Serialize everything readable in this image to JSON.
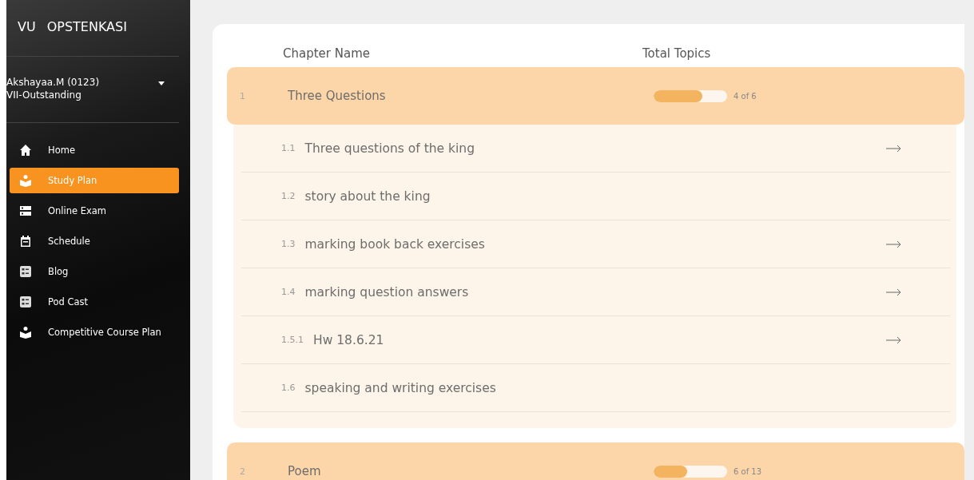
{
  "brand": {
    "short": "VU",
    "name": "OPSTENKASI"
  },
  "user": {
    "name": "Akshayaa.M (0123)",
    "class": "VII-Outstanding"
  },
  "sidebar": {
    "items": [
      {
        "label": "Home",
        "selected": false
      },
      {
        "label": "Study Plan",
        "selected": true
      },
      {
        "label": "Online Exam",
        "selected": false
      },
      {
        "label": "Schedule",
        "selected": false
      },
      {
        "label": "Blog",
        "selected": false
      },
      {
        "label": "Pod Cast",
        "selected": false
      },
      {
        "label": "Competitive Course Plan",
        "selected": false
      }
    ]
  },
  "table": {
    "columns": [
      "Chapter Name",
      "Total Topics"
    ],
    "chapters": [
      {
        "number": "1",
        "name": "Three Questions",
        "level": 0.66,
        "progress": "4 of 6",
        "expanded": true,
        "topics": [
          {
            "number": "1.1",
            "name": "Three questions of the king",
            "has_arrow": true
          },
          {
            "number": "1.2",
            "name": "story about the king",
            "has_arrow": false
          },
          {
            "number": "1.3",
            "name": "marking book back exercises",
            "has_arrow": true
          },
          {
            "number": "1.4",
            "name": "marking question answers",
            "has_arrow": true
          },
          {
            "number": "1.5.1",
            "name": "Hw 18.6.21",
            "has_arrow": true
          },
          {
            "number": "1.6",
            "name": "speaking and writing exercises",
            "has_arrow": false
          }
        ]
      },
      {
        "number": "2",
        "name": "Poem",
        "level": 0.46,
        "progress": "6 of 13",
        "expanded": false
      }
    ]
  }
}
